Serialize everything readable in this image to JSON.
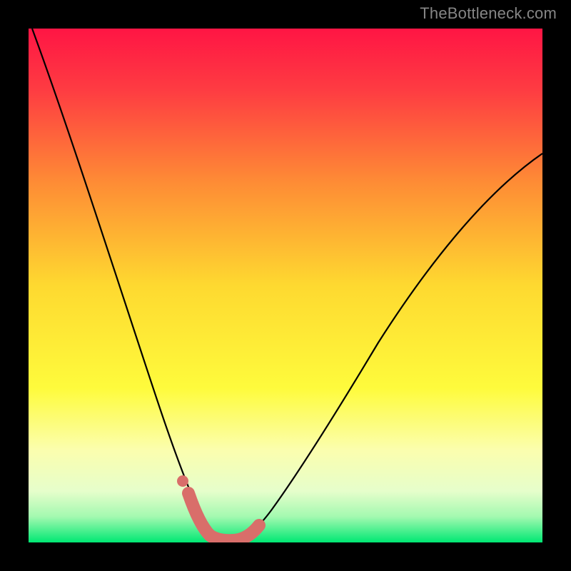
{
  "watermark": "TheBottleneck.com",
  "chart_data": {
    "type": "line",
    "title": "",
    "xlabel": "",
    "ylabel": "",
    "xlim": [
      0,
      100
    ],
    "ylim": [
      0,
      100
    ],
    "grid": false,
    "legend": false,
    "series": [
      {
        "name": "bottleneck-curve",
        "x": [
          0,
          5,
          10,
          15,
          20,
          23,
          26,
          29,
          31,
          33,
          35,
          36,
          37,
          38,
          40,
          42,
          44,
          47,
          50,
          55,
          60,
          65,
          70,
          75,
          80,
          85,
          90,
          95,
          100
        ],
        "y": [
          100,
          85,
          70,
          55,
          40,
          30,
          22,
          14,
          9,
          5,
          2,
          1,
          0,
          0,
          0,
          1,
          2,
          5,
          9,
          16,
          23,
          30,
          36,
          42,
          47,
          52,
          56,
          60,
          63
        ]
      },
      {
        "name": "highlight-band",
        "x": [
          31,
          33,
          35,
          37,
          38,
          40,
          42,
          44
        ],
        "y": [
          9,
          5,
          2,
          0,
          0,
          0,
          1,
          2
        ]
      },
      {
        "name": "highlight-dot",
        "x": [
          30
        ],
        "y": [
          12
        ]
      }
    ],
    "background_gradient": {
      "top": "#FF1847",
      "mid_upper": "#FE7F36",
      "mid": "#FEE431",
      "mid_lower": "#FDFE8F",
      "lower": "#E6FECB",
      "bottom": "#00E873"
    },
    "highlight_color": "#D96E6A",
    "curve_color": "#000000"
  }
}
